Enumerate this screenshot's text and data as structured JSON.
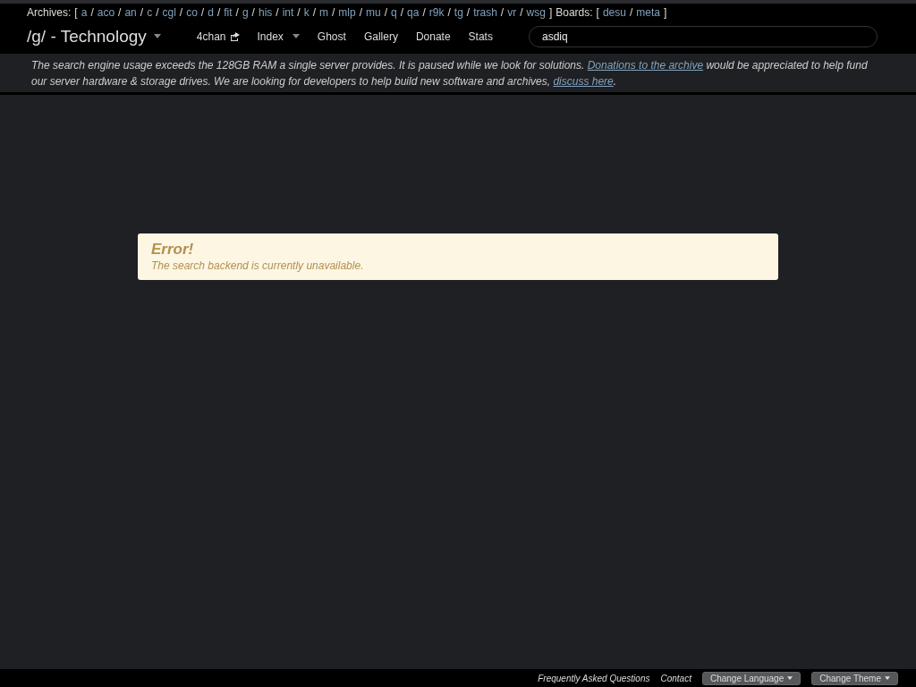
{
  "punctuation": {
    "open": "[",
    "close": "]",
    "separator": "/"
  },
  "archives": {
    "label": "Archives:",
    "boards": [
      "a",
      "aco",
      "an",
      "c",
      "cgl",
      "co",
      "d",
      "fit",
      "g",
      "his",
      "int",
      "k",
      "m",
      "mlp",
      "mu",
      "q",
      "qa",
      "r9k",
      "tg",
      "trash",
      "vr",
      "wsg"
    ]
  },
  "other_boards": {
    "label": "Boards:",
    "boards": [
      "desu",
      "meta"
    ]
  },
  "brand": "/g/ - Technology",
  "nav": [
    {
      "label": "4chan",
      "kind": "external"
    },
    {
      "label": "Index",
      "kind": "dropdown"
    },
    {
      "label": "Ghost",
      "kind": "plain"
    },
    {
      "label": "Gallery",
      "kind": "plain"
    },
    {
      "label": "Donate",
      "kind": "plain"
    },
    {
      "label": "Stats",
      "kind": "plain"
    }
  ],
  "search": {
    "value": "asdiq"
  },
  "notice": {
    "parts": [
      {
        "text": "The search engine usage exceeds the 128GB RAM a single server provides. It is paused while we look for solutions. ",
        "kind": "text"
      },
      {
        "text": "Donations to the archive",
        "kind": "link"
      },
      {
        "text": " would be appreciated to help fund our server hardware & storage drives. We are looking for developers to help build new software and archives, ",
        "kind": "text"
      },
      {
        "text": "discuss here",
        "kind": "link"
      },
      {
        "text": ".",
        "kind": "text"
      }
    ]
  },
  "error": {
    "title": "Error!",
    "message": "The search backend is currently unavailable."
  },
  "footer": {
    "links": [
      "Frequently Asked Questions",
      "Contact"
    ],
    "buttons": [
      "Change Language",
      "Change Theme"
    ]
  }
}
